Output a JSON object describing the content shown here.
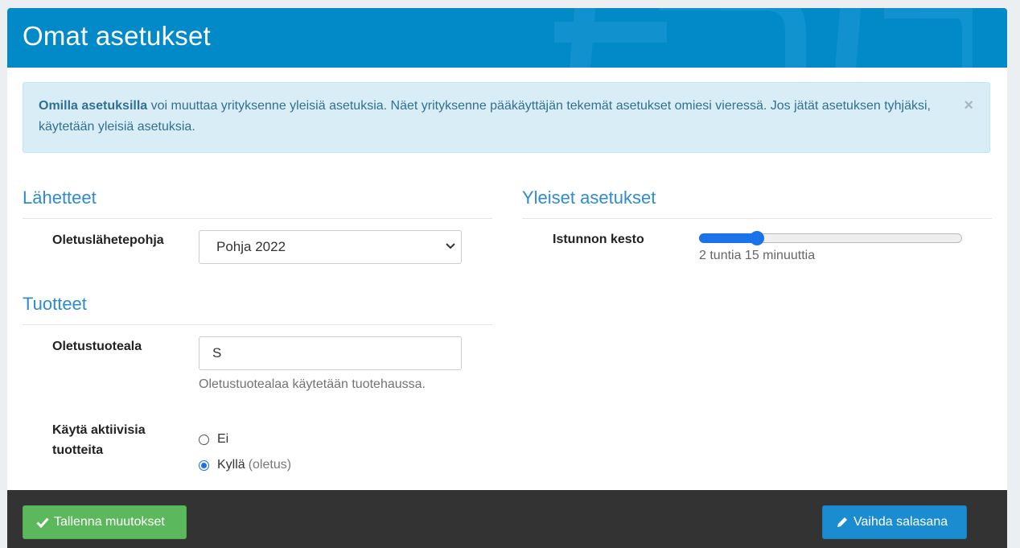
{
  "header": {
    "title": "Omat asetukset"
  },
  "alert": {
    "bold_text": "Omilla asetuksilla",
    "text": " voi muuttaa yrityksenne yleisiä asetuksia. Näet yrityksenne pääkäyttäjän tekemät asetukset omiesi vieressä. Jos jätät asetuksen tyhjäksi, käytetään yleisiä asetuksia.",
    "close_label": "×"
  },
  "sections": {
    "lahetteet": {
      "title": "Lähetteet",
      "default_template": {
        "label": "Oletuslähetepohja",
        "value": "Pohja 2022"
      }
    },
    "tuotteet": {
      "title": "Tuotteet",
      "default_product_area": {
        "label": "Oletustuoteala",
        "value": "S",
        "help": "Oletustuotealaa käytetään tuotehaussa."
      },
      "use_active_products": {
        "label_line1": "Käytä aktiivisia",
        "label_line2": "tuotteita",
        "options": [
          {
            "label": "Ei",
            "note": "",
            "checked": false
          },
          {
            "label": "Kyllä",
            "note": "(oletus)",
            "checked": true
          }
        ]
      }
    },
    "yleiset": {
      "title": "Yleiset asetukset",
      "session_length": {
        "label": "Istunnon kesto",
        "value_text": "2 tuntia 15 minuuttia",
        "fraction": 0.22
      }
    }
  },
  "footer": {
    "save_label": "Tallenna muutokset",
    "change_password_label": "Vaihda salasana"
  },
  "colors": {
    "header": "#0289c8",
    "section_title": "#2d8ccd",
    "save_button": "#5cb85c",
    "password_button": "#1a8ccf",
    "footer": "#333333"
  }
}
